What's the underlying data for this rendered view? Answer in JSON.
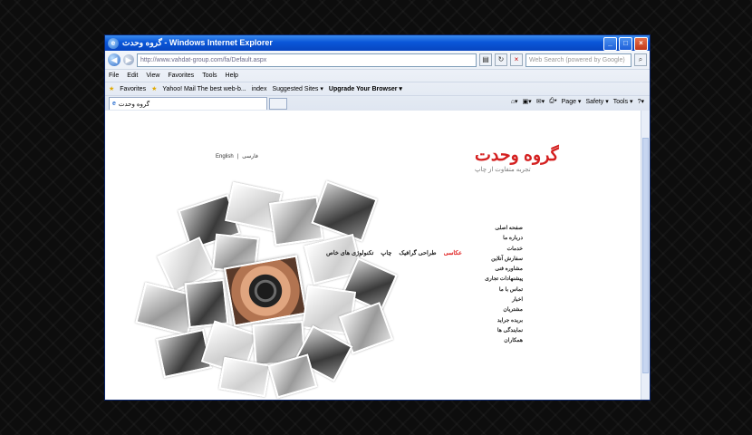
{
  "window": {
    "title": "گروه وحدت - Windows Internet Explorer"
  },
  "address_bar": {
    "url": "http://www.vahdat-group.com/fa/Default.aspx"
  },
  "search": {
    "placeholder": "Web Search (powered by Google)"
  },
  "menu": [
    "File",
    "Edit",
    "View",
    "Favorites",
    "Tools",
    "Help"
  ],
  "favorites_bar": {
    "favorites_label": "Favorites",
    "items": [
      "Yahoo! Mail The best web-b...",
      "index",
      "Suggested Sites ▾",
      "Upgrade Your Browser ▾"
    ]
  },
  "tab": {
    "title": "گروه وحدت"
  },
  "command_bar": [
    "Page ▾",
    "Safety ▾",
    "Tools ▾"
  ],
  "page": {
    "logo": "گروه وحدت",
    "tagline": "تجربه متفاوت از چاپ",
    "lang": {
      "english": "English",
      "separator": "|",
      "farsi": "فارسی"
    },
    "side_nav": [
      "صفحه اصلی",
      "درباره ما",
      "خدمات",
      "سفارش آنلاین",
      "مشاوره فنی",
      "پیشنهادات تجاری",
      "تماس با ما",
      "اخبار",
      "مشتریان",
      "بریده جراید",
      "نمایندگی ها",
      "همکاران"
    ],
    "top_nav": [
      {
        "label": "عکاسی",
        "active": true
      },
      {
        "label": "طراحی گرافیک",
        "active": false
      },
      {
        "label": "چاپ",
        "active": false
      },
      {
        "label": "تکنولوژی های خاص",
        "active": false
      }
    ]
  },
  "colors": {
    "accent": "#e02020",
    "titlebar": "#0a56d8"
  }
}
